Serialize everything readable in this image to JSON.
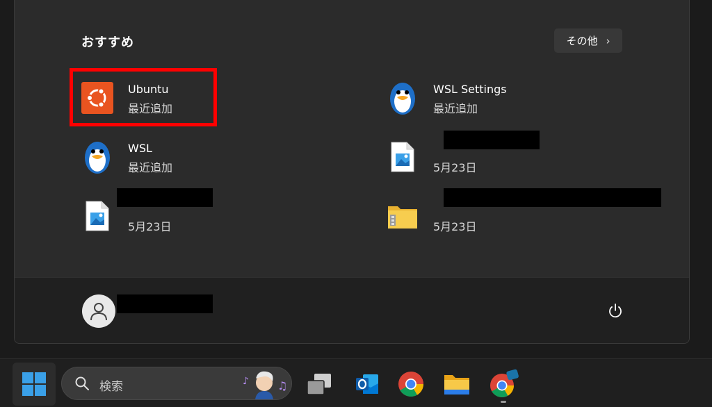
{
  "recommended": {
    "header": "おすすめ",
    "more_label": "その他",
    "items": [
      {
        "title": "Ubuntu",
        "subtitle": "最近追加",
        "icon": "ubuntu-icon"
      },
      {
        "title": "WSL Settings",
        "subtitle": "最近追加",
        "icon": "wsl-penguin-icon"
      },
      {
        "title": "WSL",
        "subtitle": "最近追加",
        "icon": "wsl-penguin-icon"
      },
      {
        "title": "",
        "subtitle": "5月23日",
        "icon": "image-file-icon"
      },
      {
        "title": "",
        "subtitle": "5月23日",
        "icon": "image-file-icon"
      },
      {
        "title": "",
        "subtitle": "5月23日",
        "icon": "zip-folder-icon"
      }
    ]
  },
  "user": {
    "icon": "user-avatar-icon"
  },
  "power": {
    "icon": "power-icon"
  },
  "taskbar": {
    "search_placeholder": "検索",
    "apps": [
      "task-view-icon",
      "outlook-icon",
      "chrome-icon",
      "file-explorer-icon",
      "chrome-dev-icon"
    ]
  },
  "colors": {
    "menu_bg": "#2b2b2b",
    "highlight": "#ff0000",
    "ubuntu_orange": "#e95420",
    "windows_blue": "#3aa0e8"
  }
}
